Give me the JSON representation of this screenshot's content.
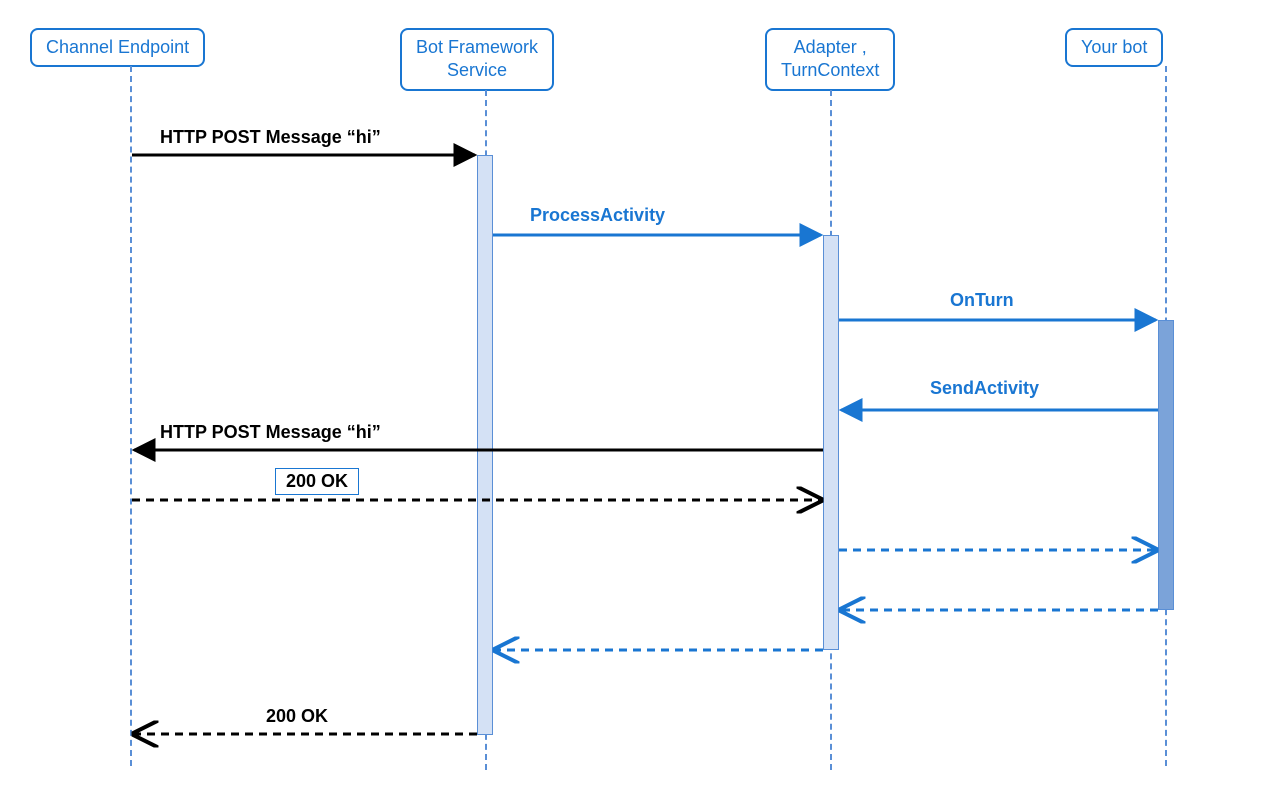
{
  "participants": {
    "channel": "Channel Endpoint",
    "botframework": "Bot Framework\nService",
    "adapter": "Adapter ,\nTurnContext",
    "yourbot": "Your bot"
  },
  "messages": {
    "httpPost1": "HTTP POST Message “hi”",
    "processActivity": "ProcessActivity",
    "onTurn": "OnTurn",
    "sendActivity": "SendActivity",
    "httpPost2": "HTTP POST Message “hi”",
    "ok1": "200 OK",
    "ok2": "200 OK"
  },
  "positions": {
    "channelX": 110,
    "botframeworkX": 465,
    "adapterX": 810,
    "yourbotX": 1145
  }
}
